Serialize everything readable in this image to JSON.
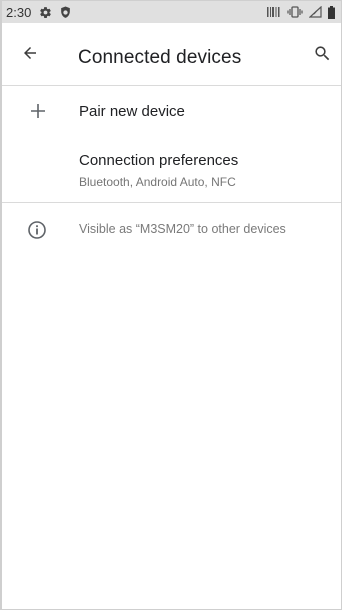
{
  "status_bar": {
    "time": "2:30",
    "left_icons": [
      "gear-icon",
      "shield-icon"
    ],
    "right_icons": [
      "barcode-icon",
      "vibrate-icon",
      "signal-icon",
      "battery-icon"
    ]
  },
  "app_bar": {
    "title": "Connected devices",
    "back_icon": "arrow-back-icon",
    "search_icon": "search-icon"
  },
  "items": {
    "pair_new_device": {
      "icon": "plus-icon",
      "label": "Pair new device"
    },
    "connection_preferences": {
      "label": "Connection preferences",
      "subtitle": "Bluetooth, Android Auto, NFC"
    }
  },
  "footer_info": {
    "icon": "info-icon",
    "text": "Visible as “M3SM20” to other devices"
  },
  "colors": {
    "status_bar_bg": "#e0e0e0",
    "primary_text": "#202124",
    "secondary_text": "#757575",
    "divider": "#dadada"
  }
}
